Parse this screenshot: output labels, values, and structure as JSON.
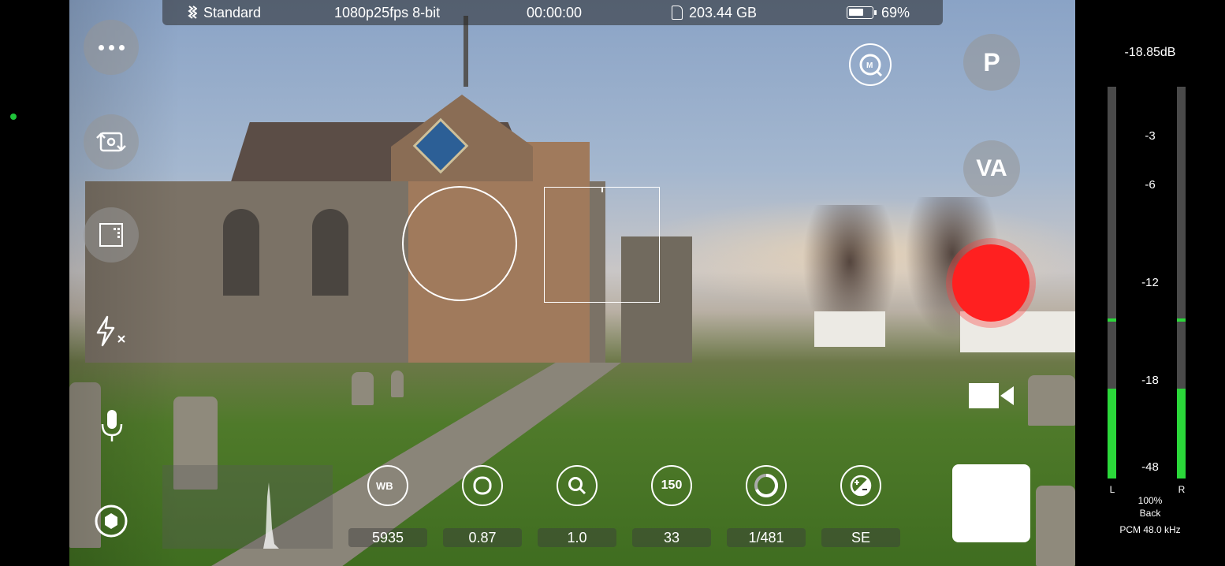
{
  "top_bar": {
    "profile": "Standard",
    "format": "1080p25fps 8-bit",
    "timecode": "00:00:00",
    "storage": "203.44 GB",
    "battery": "69%",
    "battery_level": 0.69
  },
  "right_controls": {
    "p_label": "P",
    "va_label": "VA"
  },
  "settings": [
    {
      "id": "white-balance",
      "icon_text": "WB",
      "value": "5935"
    },
    {
      "id": "tint",
      "icon_text": "",
      "value": "0.87"
    },
    {
      "id": "zoom",
      "icon_text": "",
      "value": "1.0"
    },
    {
      "id": "iso",
      "icon_text": "150",
      "value": "33"
    },
    {
      "id": "shutter",
      "icon_text": "",
      "value": "1/481"
    },
    {
      "id": "exposure-mode",
      "icon_text": "",
      "value": "SE"
    }
  ],
  "audio": {
    "level_db": "-18.85dB",
    "scale": [
      "-3",
      "-6",
      "-12",
      "-18",
      "-48"
    ],
    "left_label": "L",
    "right_label": "R",
    "left_level": 0.23,
    "right_level": 0.23,
    "left_peak": 0.4,
    "right_peak": 0.4,
    "gain": "100%",
    "mic_position": "Back",
    "codec": "PCM 48.0 kHz"
  },
  "colors": {
    "record": "#ff2020",
    "meter_green": "#2bd83a",
    "status_dot": "#1fc43a"
  }
}
